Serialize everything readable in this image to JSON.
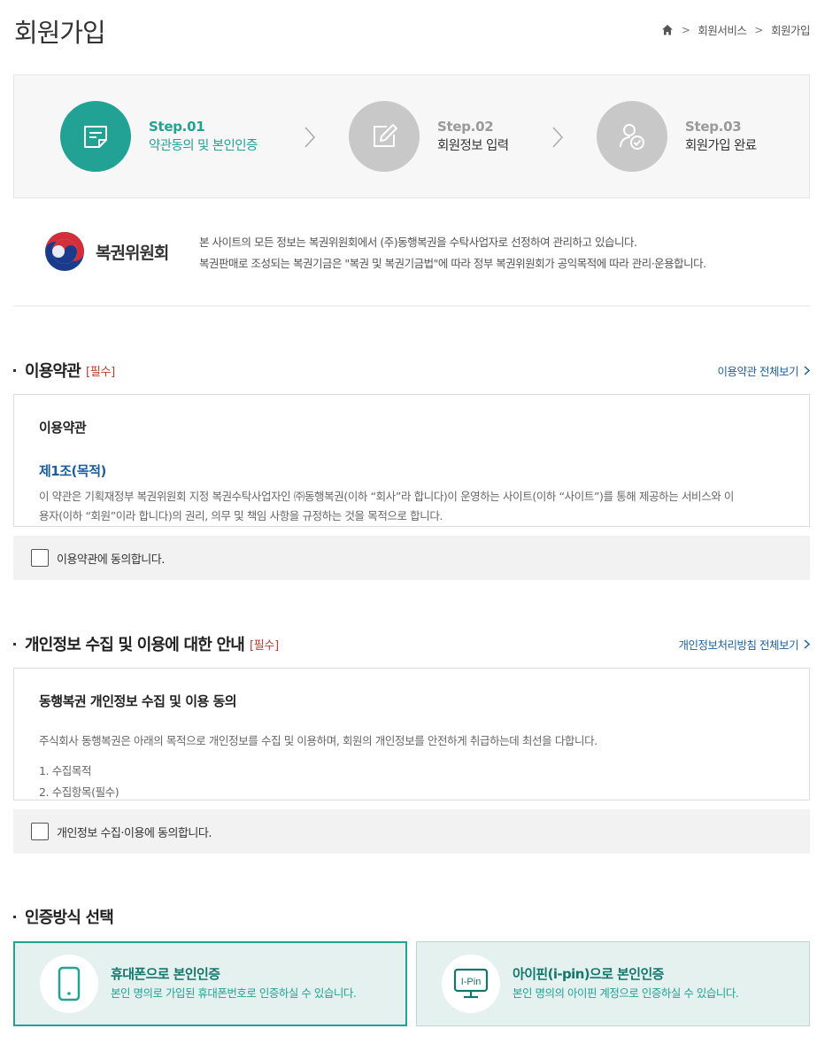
{
  "page": {
    "title": "회원가입",
    "breadcrumb": [
      "회원서비스",
      "회원가입"
    ]
  },
  "steps": [
    {
      "num": "Step.01",
      "label": "약관동의 및 본인인증",
      "icon": "document-icon",
      "state": "active"
    },
    {
      "num": "Step.02",
      "label": "회원정보 입력",
      "icon": "edit-icon",
      "state": "inactive"
    },
    {
      "num": "Step.03",
      "label": "회원가입 완료",
      "icon": "user-check-icon",
      "state": "inactive"
    }
  ],
  "notice": {
    "logo_name": "복권위원회",
    "lines": [
      "본 사이트의 모든 정보는 복권위원회에서 (주)동행복권을 수탁사업자로 선정하여 관리하고 있습니다.",
      "복권판매로 조성되는 복권기금은 \"복권 및 복권기금법\"에 따라 정부 복권위원회가 공익목적에 따라 관리·운용합니다."
    ]
  },
  "terms": {
    "title": "이용약관",
    "required": "[필수]",
    "view_all": "이용약관 전체보기",
    "box_heading": "이용약관",
    "article_title": "제1조(목적)",
    "article_body_1": "이 약관은 기획재정부 복권위원회 지정 복권수탁사업자인 ㈜동행복권(이하 “회사”라 합니다)이 운영하는 사이트(이하 “사이트”)를 통해 제공하는 서비스와 이",
    "article_body_2": "용자(이하 “회원”이라 합니다)의 권리, 의무 및 책임 사항을 규정하는 것을 목적으로 합니다.",
    "agree_label": "이용약관에 동의합니다."
  },
  "privacy": {
    "title": "개인정보 수집 및 이용에 대한 안내",
    "required": "[필수]",
    "view_all": "개인정보처리방침 전체보기",
    "box_heading": "동행복권 개인정보 수집 및 이용 동의",
    "intro": "주식회사 동행복권은 아래의 목적으로 개인정보를 수집 및 이용하며, 회원의 개인정보를 안전하게 취급하는데 최선을 다합니다.",
    "item_1": "1. 수집목적",
    "item_2": "2. 수집항목(필수)",
    "agree_label": "개인정보 수집·이용에 동의합니다."
  },
  "auth": {
    "title": "인증방식 선택",
    "options": [
      {
        "title": "휴대폰으로 본인인증",
        "desc": "본인 명의로 가입된 휴대폰번호로 인증하실 수 있습니다.",
        "icon": "mobile-phone-icon",
        "selected": true
      },
      {
        "title": "아이핀(i-pin)으로 본인인증",
        "desc": "본인 명의의 아이핀 계정으로 인증하실 수 있습니다.",
        "icon": "ipin-monitor-icon",
        "icon_text": "I-Pin",
        "selected": false
      }
    ]
  },
  "colors": {
    "accent": "#22a294",
    "inactive": "#c8c8c8",
    "link": "#1d5f9e",
    "required": "#c0392b"
  }
}
